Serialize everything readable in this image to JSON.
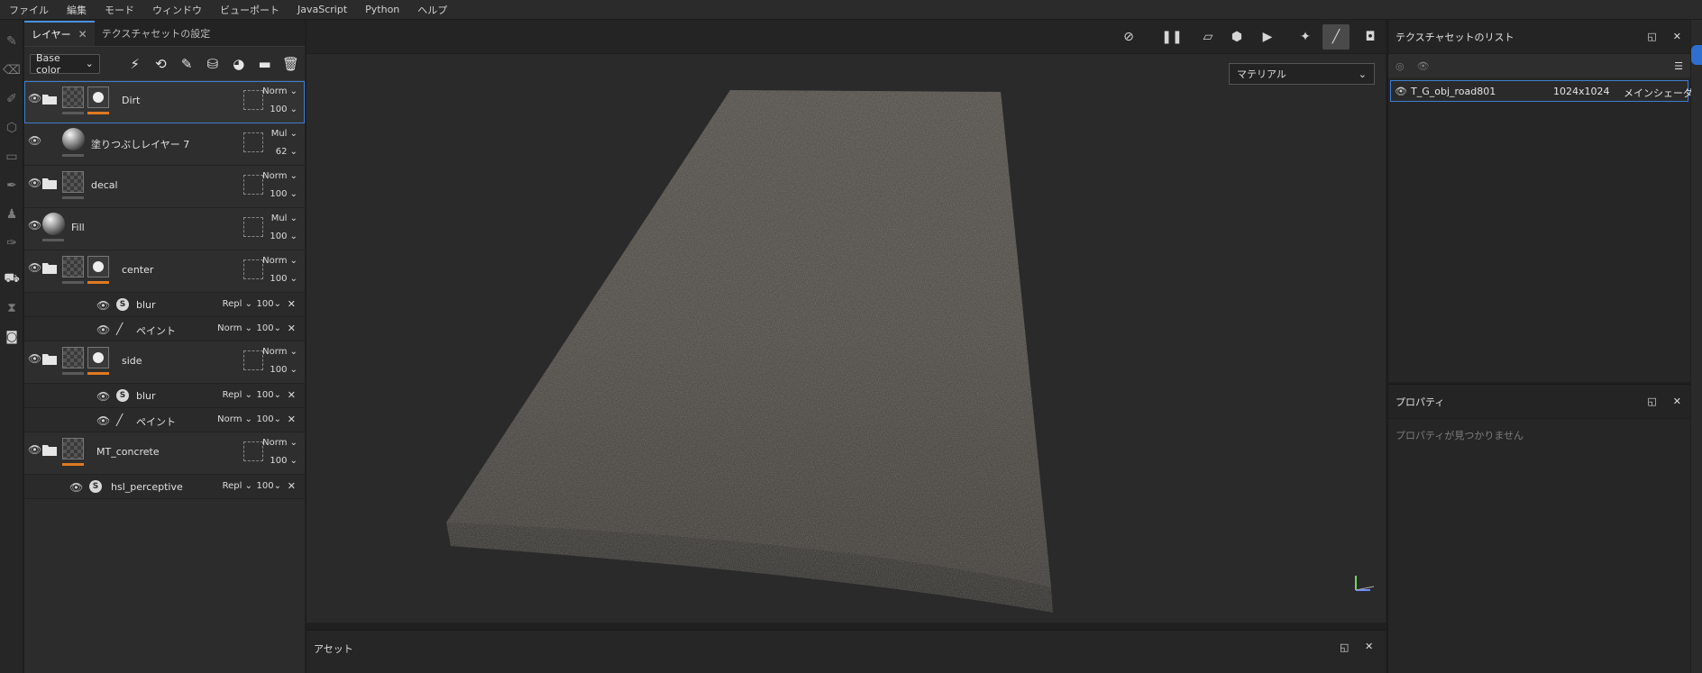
{
  "menu": [
    "ファイル",
    "編集",
    "モード",
    "ウィンドウ",
    "ビューポート",
    "JavaScript",
    "Python",
    "ヘルプ"
  ],
  "layers_panel": {
    "tab_layers": "レイヤー",
    "tab_texset_settings": "テクスチャセットの設定",
    "channel_select": "Base color",
    "layers": [
      {
        "name": "Dirt",
        "blend": "Norm",
        "opacity": "100"
      },
      {
        "name": "塗りつぶしレイヤー 7",
        "blend": "Mul",
        "opacity": "62"
      },
      {
        "name": "decal",
        "blend": "Norm",
        "opacity": "100"
      },
      {
        "name": "Fill",
        "blend": "Mul",
        "opacity": "100"
      },
      {
        "name": "center",
        "blend": "Norm",
        "opacity": "100",
        "effects": [
          {
            "name": "blur",
            "blend": "Repl",
            "opacity": "100"
          },
          {
            "name": "ペイント",
            "blend": "Norm",
            "opacity": "100"
          }
        ]
      },
      {
        "name": "side",
        "blend": "Norm",
        "opacity": "100",
        "effects": [
          {
            "name": "blur",
            "blend": "Repl",
            "opacity": "100"
          },
          {
            "name": "ペイント",
            "blend": "Norm",
            "opacity": "100"
          }
        ]
      },
      {
        "name": "MT_concrete",
        "blend": "Norm",
        "opacity": "100",
        "effects": [
          {
            "name": "hsl_perceptive",
            "blend": "Repl",
            "opacity": "100"
          }
        ]
      }
    ]
  },
  "viewport": {
    "material_select": "マテリアル"
  },
  "assets": {
    "title": "アセット"
  },
  "texture_sets": {
    "title": "テクスチャセットのリスト",
    "rows": [
      {
        "name": "T_G_obj_road801",
        "resolution": "1024x1024",
        "shader": "メインシェーダー"
      }
    ]
  },
  "properties": {
    "title": "プロパティ",
    "empty": "プロパティが見つかりません"
  },
  "colors": {
    "accent": "#3d7fd1",
    "mask_bar": "#e07a1f",
    "background": "#2a2a2a"
  }
}
